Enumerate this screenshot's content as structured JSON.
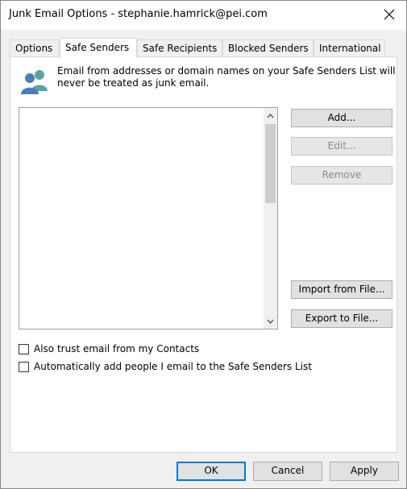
{
  "window": {
    "title": "Junk Email Options - stephanie.hamrick@pei.com",
    "close_icon": "close-icon"
  },
  "tabs": [
    {
      "label": "Options",
      "active": false
    },
    {
      "label": "Safe Senders",
      "active": true
    },
    {
      "label": "Safe Recipients",
      "active": false
    },
    {
      "label": "Blocked Senders",
      "active": false
    },
    {
      "label": "International",
      "active": false
    }
  ],
  "safe_senders": {
    "icon": "people-icon",
    "description": "Email from addresses or domain names on your Safe Senders List will never be treated as junk email.",
    "list_items": [],
    "buttons": {
      "add": "Add...",
      "edit": "Edit...",
      "remove": "Remove",
      "import": "Import from File...",
      "export": "Export to File..."
    },
    "checkboxes": [
      {
        "label": "Also trust email from my Contacts",
        "checked": false
      },
      {
        "label": "Automatically add people I email to the Safe Senders List",
        "checked": false
      }
    ]
  },
  "footer": {
    "ok": "OK",
    "cancel": "Cancel",
    "apply": "Apply"
  },
  "colors": {
    "accent": "#0078d7",
    "icon_blue": "#4a7fb5",
    "icon_teal": "#5aa5a0"
  }
}
